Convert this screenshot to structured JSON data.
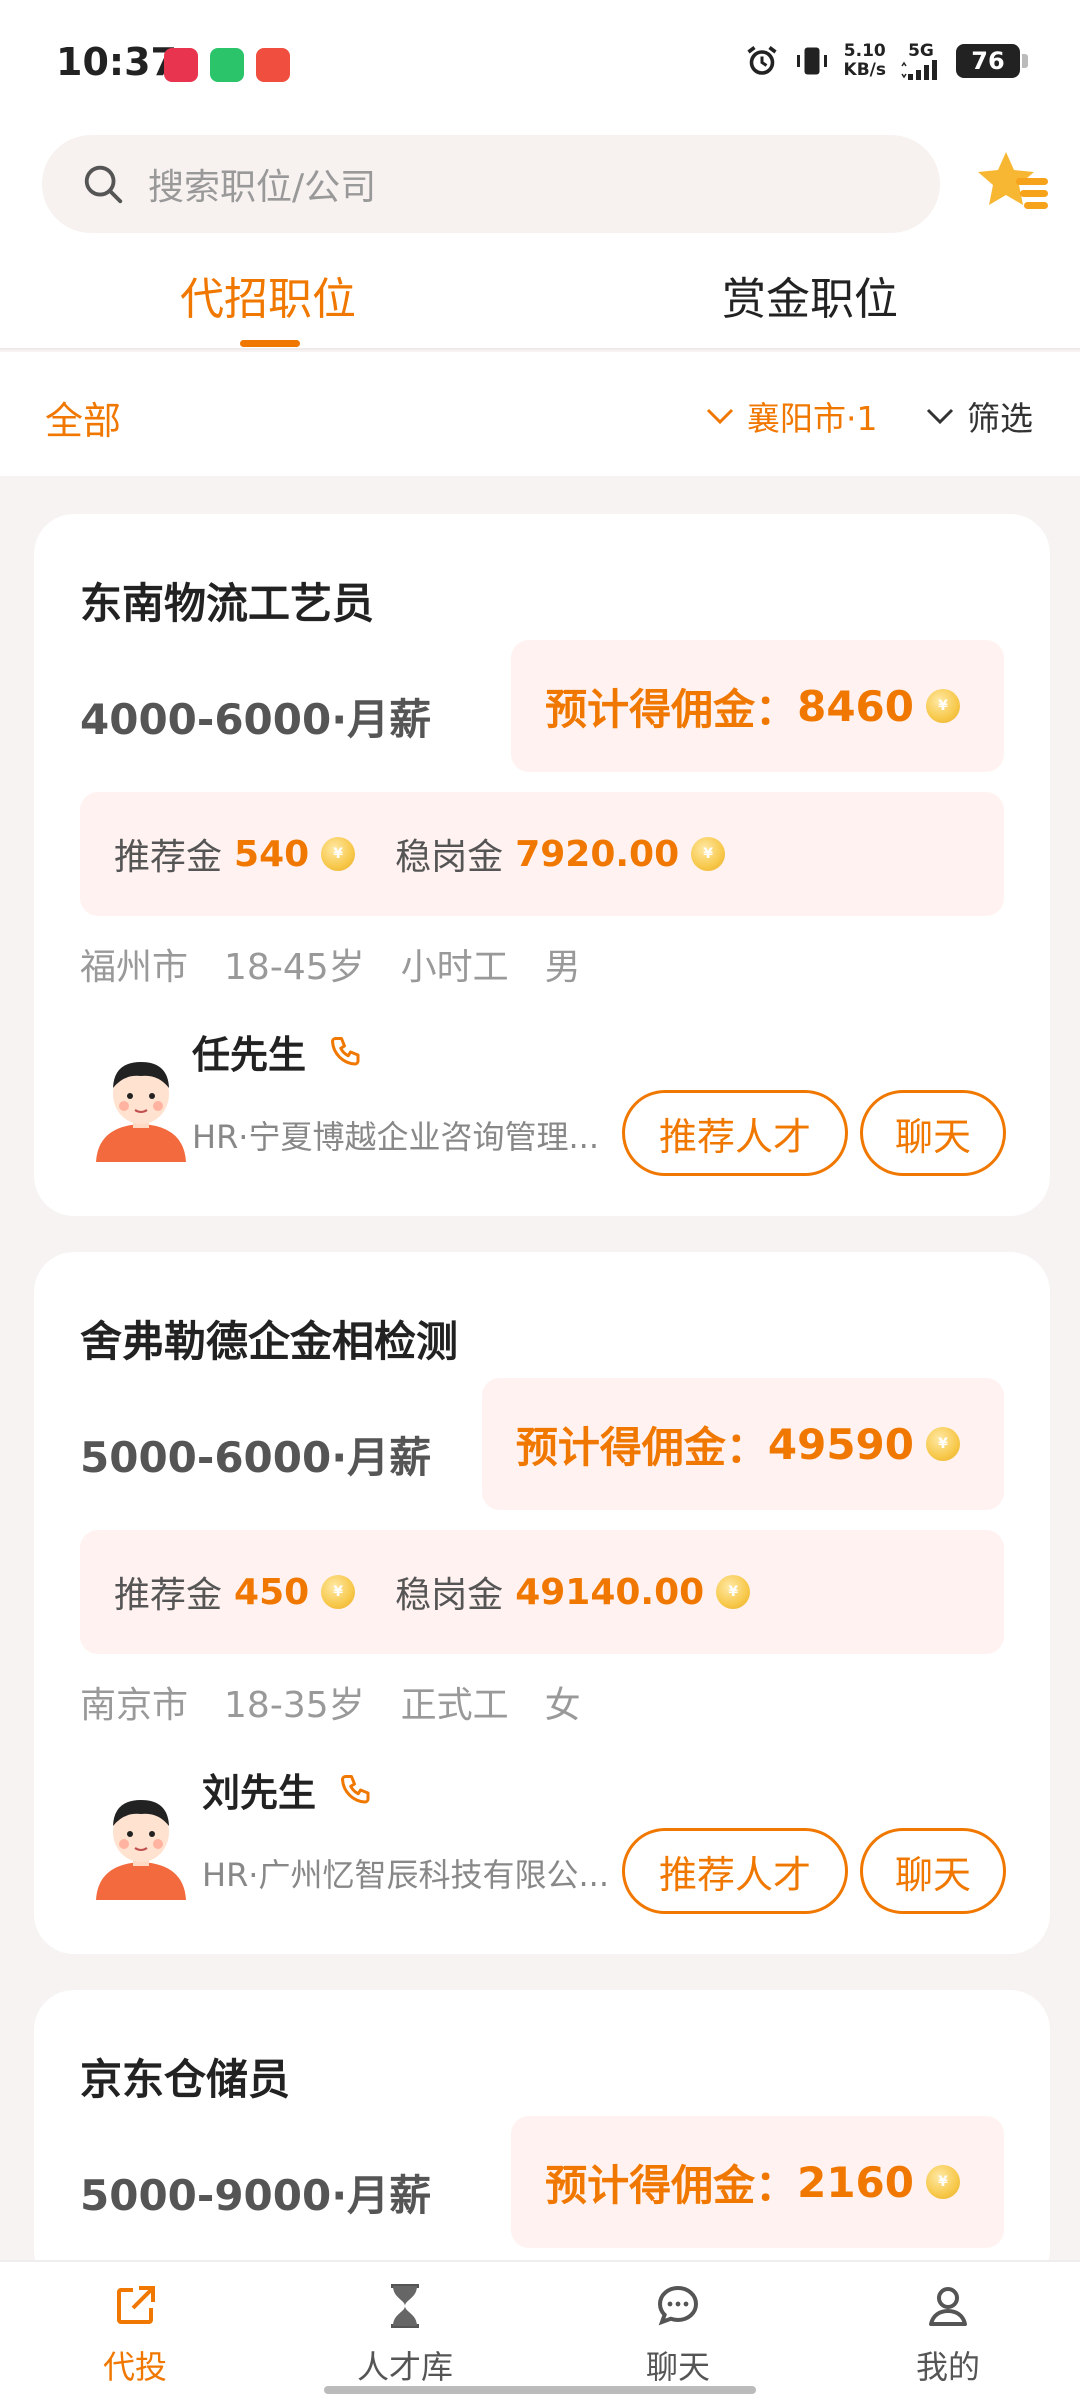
{
  "status_bar": {
    "time": "10:37",
    "speed_value": "5.10",
    "speed_unit": "KB/s",
    "network": "5G",
    "battery": "76"
  },
  "search": {
    "placeholder": "搜索职位/公司"
  },
  "tabs": [
    {
      "label": "代招职位",
      "active": true
    },
    {
      "label": "赏金职位",
      "active": false
    }
  ],
  "filter": {
    "all_label": "全部",
    "city_label": "襄阳市·1",
    "screen_label": "筛选"
  },
  "jobs": [
    {
      "title": "东南物流工艺员",
      "salary": "4000-6000·月薪",
      "commission_label": "预计得佣金：",
      "commission_value": "8460",
      "referral_label": "推荐金",
      "referral_value": "540",
      "retention_label": "稳岗金",
      "retention_value": "7920.00",
      "tags": [
        "福州市",
        "18-45岁",
        "小时工",
        "男"
      ],
      "hr_name": "任先生",
      "hr_company": "HR·宁夏博越企业咨询管理...",
      "btn_recommend": "推荐人才",
      "btn_chat": "聊天"
    },
    {
      "title": "舍弗勒德企金相检测",
      "salary": "5000-6000·月薪",
      "commission_label": "预计得佣金：",
      "commission_value": "49590",
      "referral_label": "推荐金",
      "referral_value": "450",
      "retention_label": "稳岗金",
      "retention_value": "49140.00",
      "tags": [
        "南京市",
        "18-35岁",
        "正式工",
        "女"
      ],
      "hr_name": "刘先生",
      "hr_company": "HR·广州忆智辰科技有限公...",
      "btn_recommend": "推荐人才",
      "btn_chat": "聊天"
    },
    {
      "title": "京东仓储员",
      "salary": "5000-9000·月薪",
      "commission_label": "预计得佣金：",
      "commission_value": "2160"
    }
  ],
  "bottom_nav": [
    {
      "label": "代投",
      "icon": "share-icon",
      "active": true
    },
    {
      "label": "人才库",
      "icon": "hourglass-icon",
      "active": false
    },
    {
      "label": "聊天",
      "icon": "chat-bubble-icon",
      "active": false
    },
    {
      "label": "我的",
      "icon": "user-icon",
      "active": false
    }
  ],
  "colors": {
    "accent": "#f07800",
    "pale_accent": "#fff2f0"
  }
}
